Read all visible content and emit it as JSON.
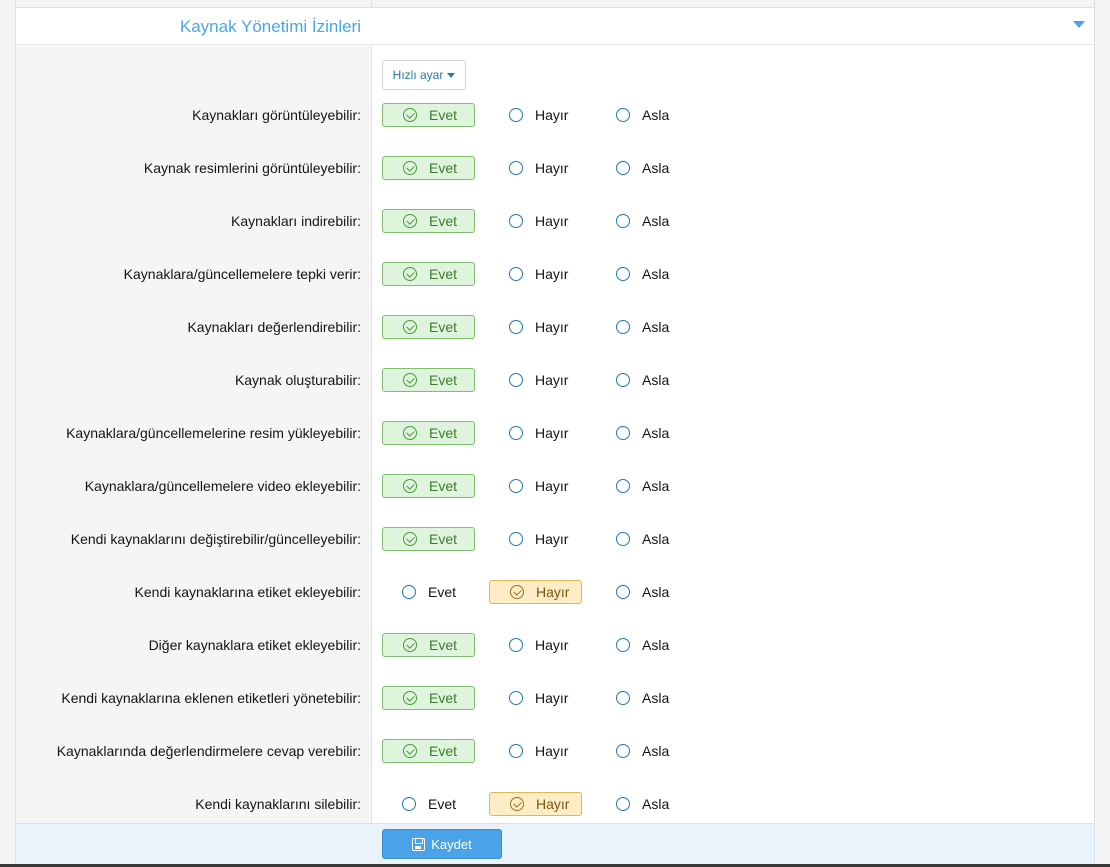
{
  "section": {
    "title": "Kaynak Yönetimi İzinleri"
  },
  "quick_set": {
    "label": "Hızlı ayar"
  },
  "option_labels": {
    "yes": "Evet",
    "no": "Hayır",
    "never": "Asla"
  },
  "colors": {
    "accent": "#47a7eb",
    "selected_yes_bg": "#dff4dc",
    "selected_no_bg": "#fdedc5"
  },
  "permissions": [
    {
      "label": "Kaynakları görüntüleyebilir:",
      "value": "yes"
    },
    {
      "label": "Kaynak resimlerini görüntüleyebilir:",
      "value": "yes"
    },
    {
      "label": "Kaynakları indirebilir:",
      "value": "yes"
    },
    {
      "label": "Kaynaklara/güncellemelere tepki verir:",
      "value": "yes"
    },
    {
      "label": "Kaynakları değerlendirebilir:",
      "value": "yes"
    },
    {
      "label": "Kaynak oluşturabilir:",
      "value": "yes"
    },
    {
      "label": "Kaynaklara/güncellemelerine resim yükleyebilir:",
      "value": "yes"
    },
    {
      "label": "Kaynaklara/güncellemelere video ekleyebilir:",
      "value": "yes"
    },
    {
      "label": "Kendi kaynaklarını değiştirebilir/güncelleyebilir:",
      "value": "yes"
    },
    {
      "label": "Kendi kaynaklarına etiket ekleyebilir:",
      "value": "no"
    },
    {
      "label": "Diğer kaynaklara etiket ekleyebilir:",
      "value": "yes"
    },
    {
      "label": "Kendi kaynaklarına eklenen etiketleri yönetebilir:",
      "value": "yes"
    },
    {
      "label": "Kaynaklarında değerlendirmelere cevap verebilir:",
      "value": "yes"
    },
    {
      "label": "Kendi kaynaklarını silebilir:",
      "value": "no"
    }
  ],
  "footer": {
    "save_label": "Kaydet"
  }
}
